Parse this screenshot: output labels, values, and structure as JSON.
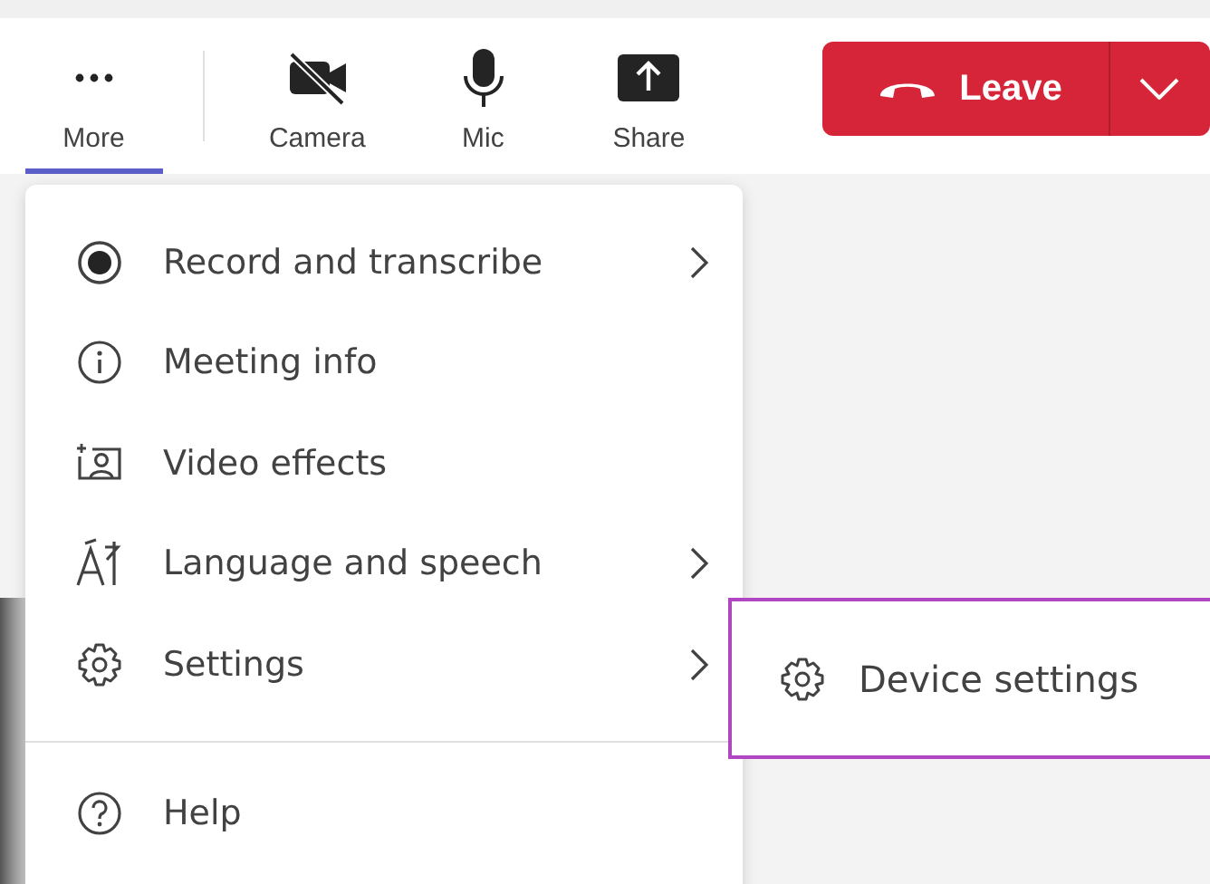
{
  "toolbar": {
    "items": [
      {
        "label": "More",
        "kind": "more",
        "selected": true
      },
      {
        "label": "Camera",
        "kind": "camera",
        "selected": false
      },
      {
        "label": "Mic",
        "kind": "mic",
        "selected": false
      },
      {
        "label": "Share",
        "kind": "share",
        "selected": false
      }
    ],
    "leave_button": {
      "label": "Leave"
    }
  },
  "menu": {
    "items": [
      {
        "label": "Record and transcribe",
        "kind": "record",
        "submenu": true
      },
      {
        "label": "Meeting info",
        "kind": "info",
        "submenu": false
      },
      {
        "label": "Video effects",
        "kind": "effects",
        "submenu": false
      },
      {
        "label": "Language and speech",
        "kind": "language",
        "submenu": true
      },
      {
        "label": "Settings",
        "kind": "settings",
        "submenu": true
      },
      {
        "label": "Help",
        "kind": "help",
        "submenu": false
      }
    ]
  },
  "submenu": {
    "items": [
      {
        "label": "Device settings",
        "kind": "settings",
        "focused": true
      }
    ]
  }
}
